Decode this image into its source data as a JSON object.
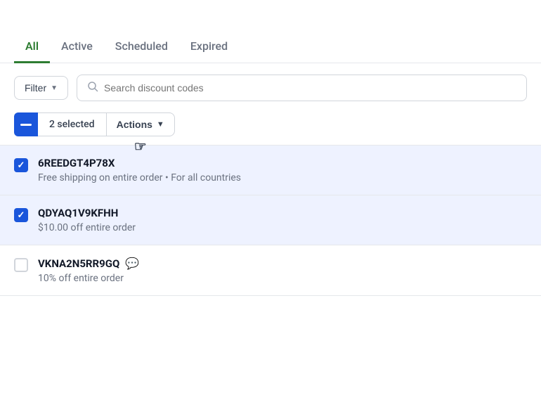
{
  "tabs": [
    {
      "id": "all",
      "label": "All",
      "active": true
    },
    {
      "id": "active",
      "label": "Active",
      "active": false
    },
    {
      "id": "scheduled",
      "label": "Scheduled",
      "active": false
    },
    {
      "id": "expired",
      "label": "Expired",
      "active": false
    }
  ],
  "toolbar": {
    "filter_label": "Filter",
    "search_placeholder": "Search discount codes"
  },
  "selection": {
    "count": "2 selected",
    "actions_label": "Actions"
  },
  "discount_items": [
    {
      "code": "6REEDGT4P78X",
      "description": "Free shipping on entire order • For all countries",
      "checked": true
    },
    {
      "code": "QDYAQ1V9KFHH",
      "description": "$10.00 off entire order",
      "checked": true
    },
    {
      "code": "VKNA2N5RR9GQ",
      "description": "10% off entire order",
      "checked": false,
      "has_badge": true
    }
  ],
  "colors": {
    "active_tab": "#2e7d32",
    "checkbox_blue": "#1a56db",
    "selected_row_bg": "#eef2ff"
  }
}
